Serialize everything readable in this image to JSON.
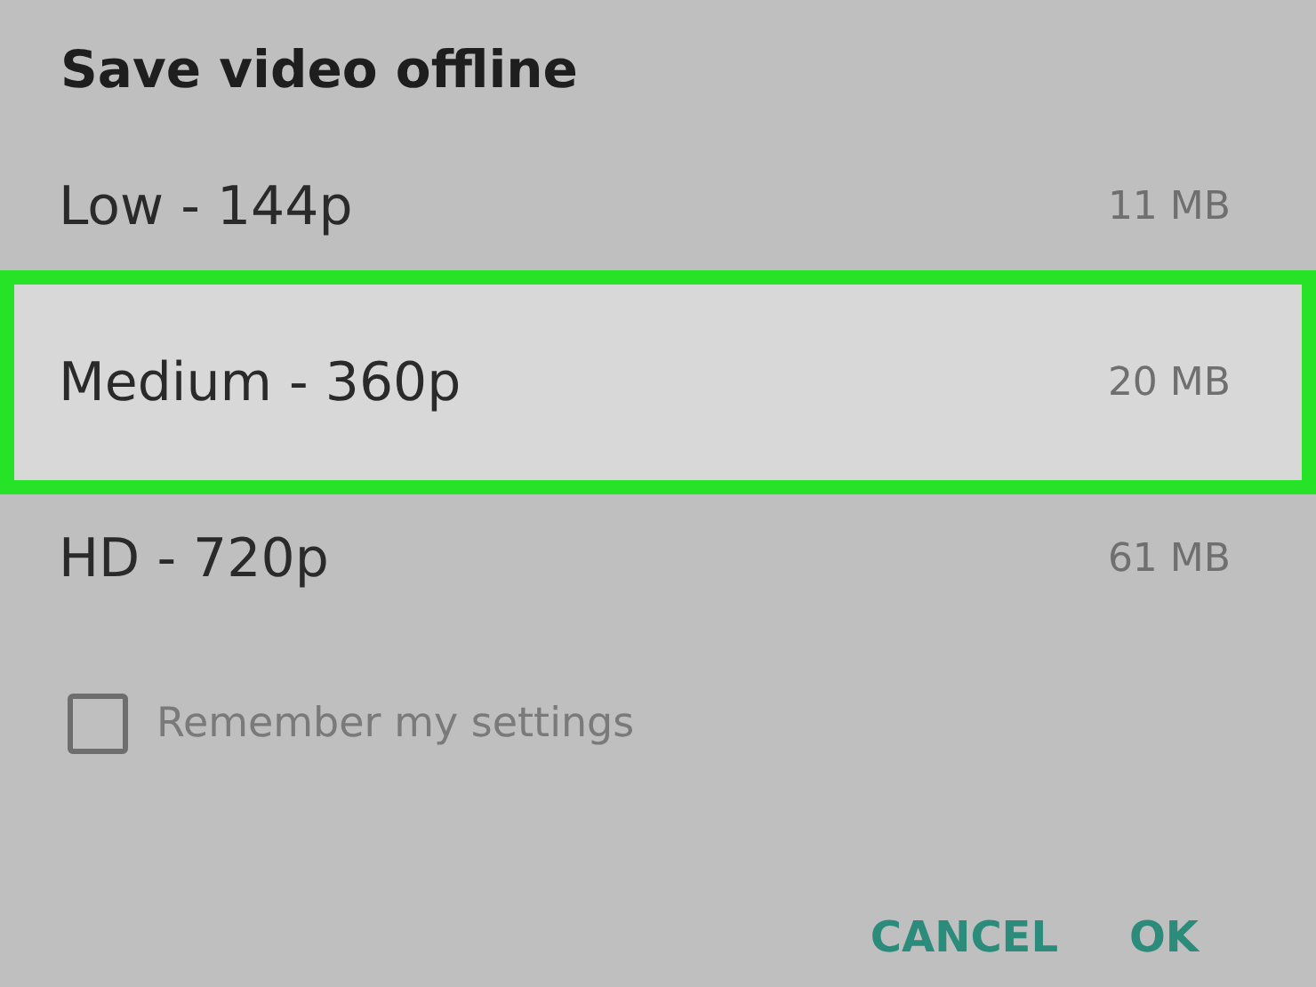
{
  "dialog": {
    "title": "Save video offline",
    "options": [
      {
        "label": "Low - 144p",
        "size": "11 MB",
        "selected": false
      },
      {
        "label": "Medium - 360p",
        "size": "20 MB",
        "selected": true
      },
      {
        "label": "HD - 720p",
        "size": "61 MB",
        "selected": false
      }
    ],
    "remember": {
      "label": "Remember my settings",
      "checked": false
    },
    "buttons": [
      "CANCEL",
      "OK"
    ]
  }
}
